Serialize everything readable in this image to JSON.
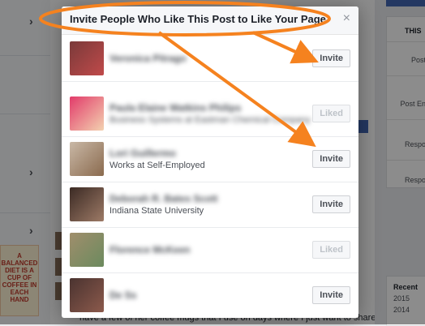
{
  "dialog": {
    "title": "Invite People Who Like This Post to Like Your Page",
    "close_glyph": "×"
  },
  "people": [
    {
      "name": "Veronica Pitrago",
      "subtitle": "",
      "action": "Invite",
      "name_blurred": true,
      "sub_blurred": false,
      "avatar_colors": [
        "#7a3a3a",
        "#c04a4a"
      ]
    },
    {
      "name": "Paula Elaine Watkins Philips",
      "subtitle": "Business Systems at Eastman Chemical Company",
      "action": "Liked",
      "name_blurred": true,
      "sub_blurred": true,
      "avatar_colors": [
        "#e23b6a",
        "#f3d2b0"
      ]
    },
    {
      "name": "Lori Guillermo",
      "subtitle": "Works at Self-Employed",
      "action": "Invite",
      "name_blurred": true,
      "sub_blurred": false,
      "avatar_colors": [
        "#c9b8a6",
        "#8a6a4e"
      ]
    },
    {
      "name": "Deborah R. Bates Scott",
      "subtitle": "Indiana State University",
      "action": "Invite",
      "name_blurred": true,
      "sub_blurred": false,
      "avatar_colors": [
        "#3b2a24",
        "#9d7a66"
      ]
    },
    {
      "name": "Florence McKeen",
      "subtitle": "",
      "action": "Liked",
      "name_blurred": true,
      "sub_blurred": false,
      "avatar_colors": [
        "#a08e6c",
        "#6b8a5e"
      ]
    },
    {
      "name": "De Ss",
      "subtitle": "",
      "action": "Invite",
      "name_blurred": true,
      "sub_blurred": false,
      "avatar_colors": [
        "#4a3330",
        "#8c5a4c"
      ]
    }
  ],
  "background": {
    "footer_text": "have a few of her coffee mugs that I use on days where I just want to share a",
    "right_panel_title": "THIS",
    "right_panel_items": [
      "Post",
      "Post En",
      "Respo",
      "Respo"
    ],
    "recent_title": "Recent",
    "years": [
      "2015",
      "2014"
    ],
    "ad_text": "A BALANCED DIET IS A CUP OF COFFEE IN EACH HAND"
  },
  "colors": {
    "annotation": "#f5821f",
    "link": "#365899",
    "brand": "#4267b2"
  }
}
